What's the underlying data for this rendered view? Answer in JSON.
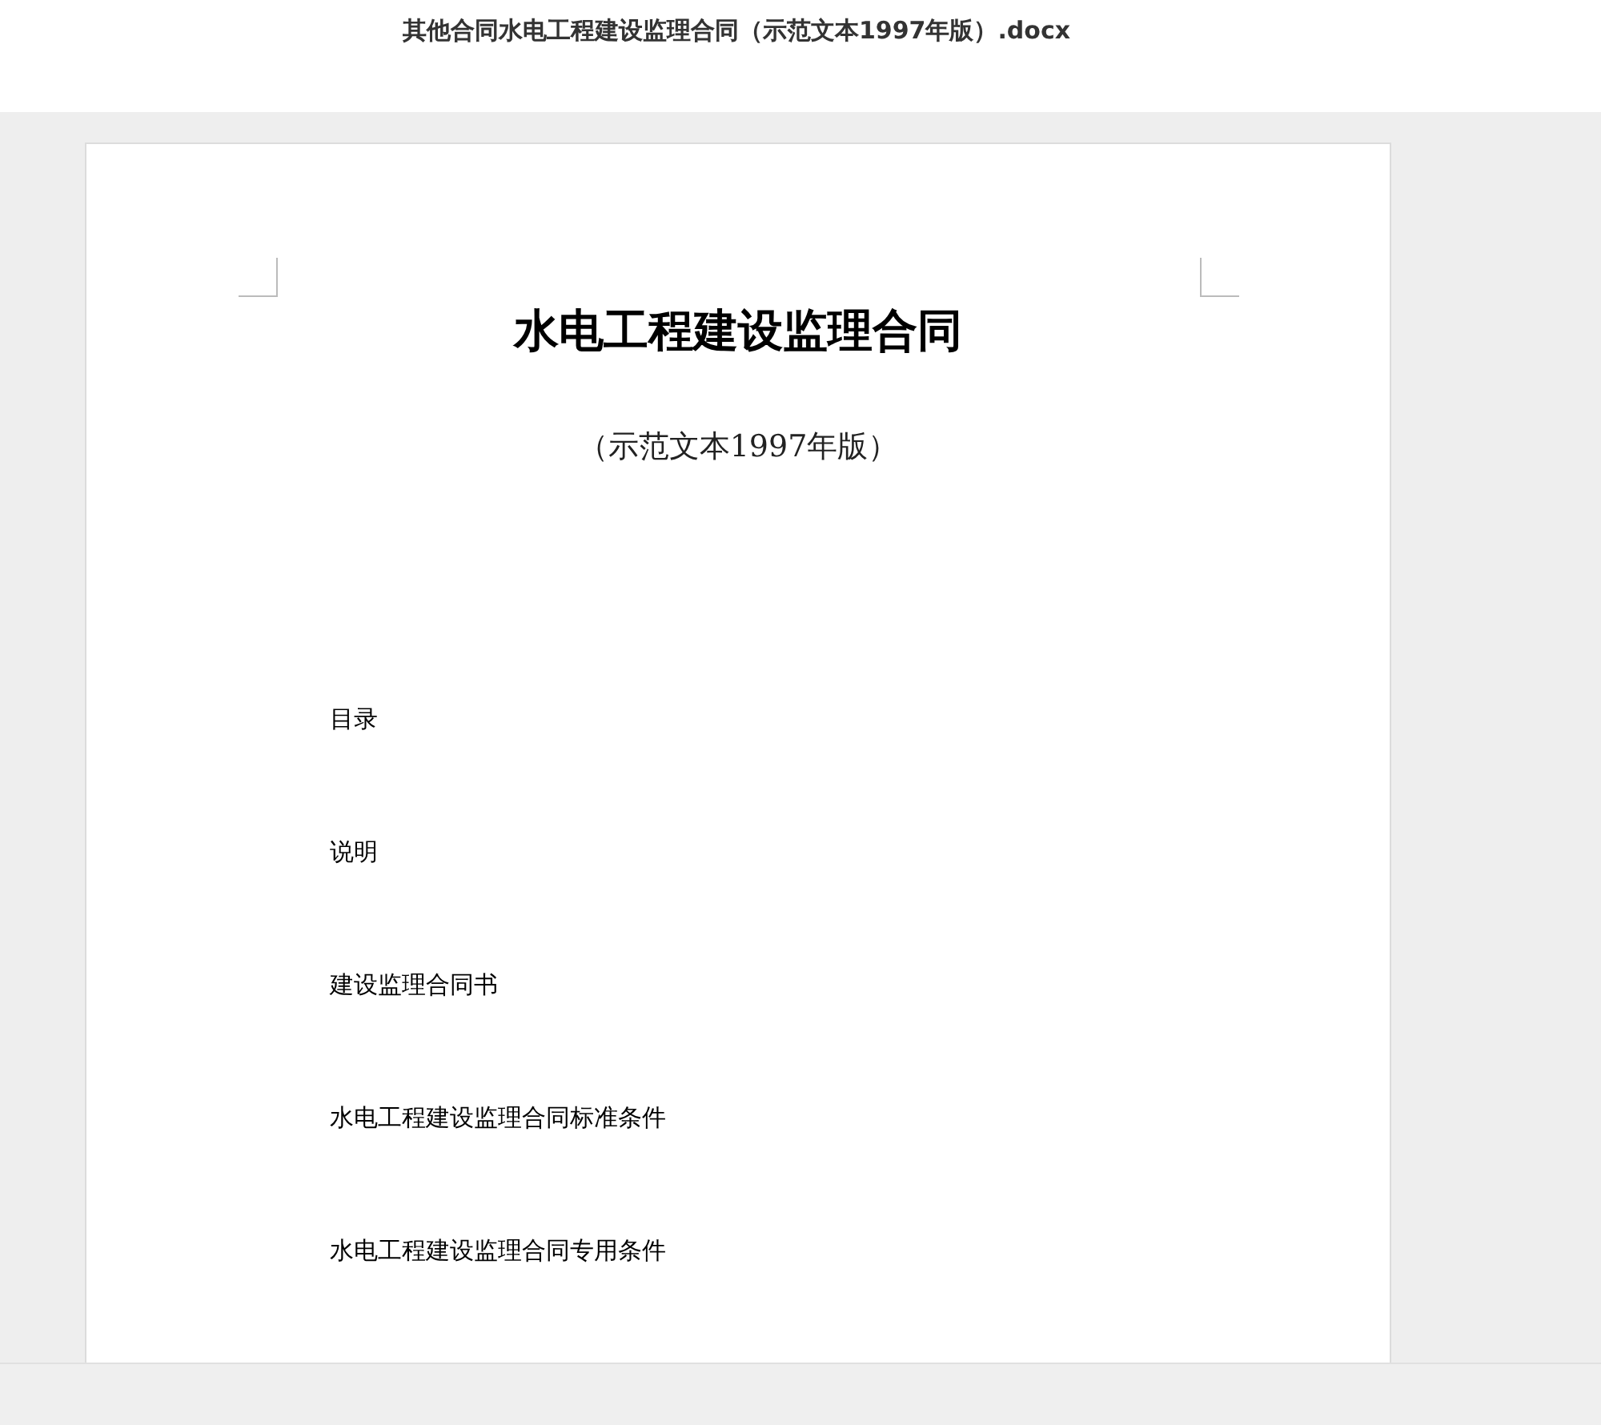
{
  "window": {
    "title": "其他合同水电工程建设监理合同（示范文本1997年版）.docx"
  },
  "document": {
    "title": "水电工程建设监理合同",
    "subtitle": "（示范文本1997年版）",
    "contents": [
      "目录",
      "说明",
      "建设监理合同书",
      "水电工程建设监理合同标准条件",
      "水电工程建设监理合同专用条件"
    ]
  }
}
